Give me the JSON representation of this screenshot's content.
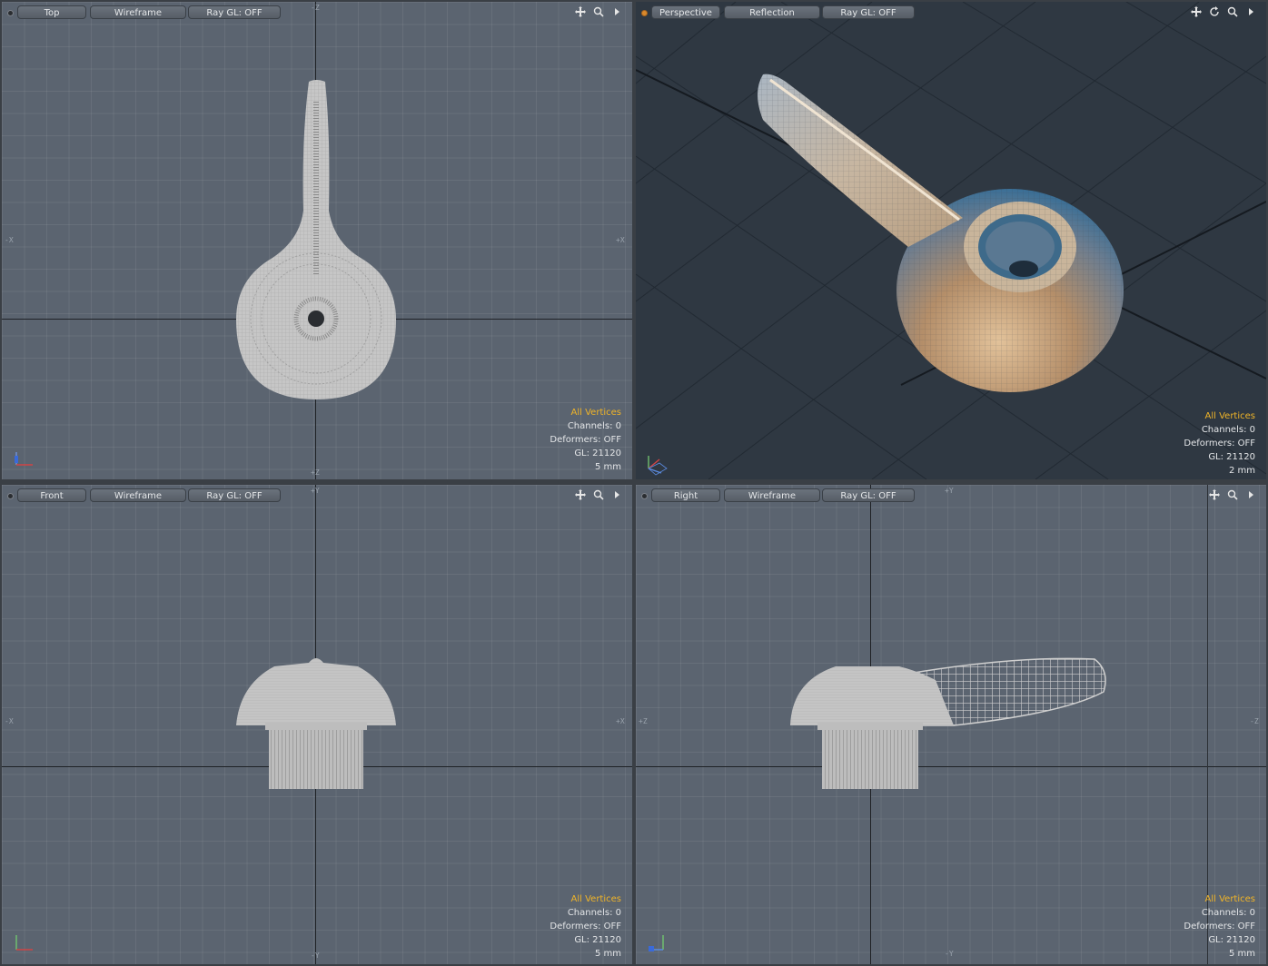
{
  "viewports": {
    "top": {
      "view_label": "Top",
      "style_label": "Wireframe",
      "raygl_label": "Ray GL: OFF",
      "axis": {
        "top": "-Z",
        "bottom": "+Z",
        "left": "-X",
        "right": "+X"
      },
      "info": {
        "selection": "All Vertices",
        "channels": "Channels: 0",
        "deformers": "Deformers: OFF",
        "gl": "GL: 21120",
        "grid": "5 mm"
      },
      "icons": [
        "move-icon",
        "zoom-icon",
        "menu-arrow-icon"
      ]
    },
    "perspective": {
      "view_label": "Perspective",
      "style_label": "Reflection",
      "raygl_label": "Ray GL: OFF",
      "info": {
        "selection": "All Vertices",
        "channels": "Channels: 0",
        "deformers": "Deformers: OFF",
        "gl": "GL: 21120",
        "grid": "2 mm"
      },
      "icons": [
        "move-icon",
        "rotate-icon",
        "zoom-icon",
        "menu-arrow-icon"
      ]
    },
    "front": {
      "view_label": "Front",
      "style_label": "Wireframe",
      "raygl_label": "Ray GL: OFF",
      "axis": {
        "top": "+Y",
        "bottom": "-Y",
        "left": "-X",
        "right": "+X"
      },
      "info": {
        "selection": "All Vertices",
        "channels": "Channels: 0",
        "deformers": "Deformers: OFF",
        "gl": "GL: 21120",
        "grid": "5 mm"
      },
      "icons": [
        "move-icon",
        "zoom-icon",
        "menu-arrow-icon"
      ]
    },
    "right": {
      "view_label": "Right",
      "style_label": "Wireframe",
      "raygl_label": "Ray GL: OFF",
      "axis": {
        "top": "+Y",
        "bottom": "-Y",
        "left": "+Z",
        "right": "-Z"
      },
      "info": {
        "selection": "All Vertices",
        "channels": "Channels: 0",
        "deformers": "Deformers: OFF",
        "gl": "GL: 21120",
        "grid": "5 mm"
      },
      "icons": [
        "move-icon",
        "zoom-icon",
        "menu-arrow-icon"
      ]
    }
  },
  "colors": {
    "selection_text": "#f0b428",
    "viewport_bg": "#5b6470",
    "perspective_bg": "#2f3842",
    "mesh": "#c8c8c8"
  }
}
